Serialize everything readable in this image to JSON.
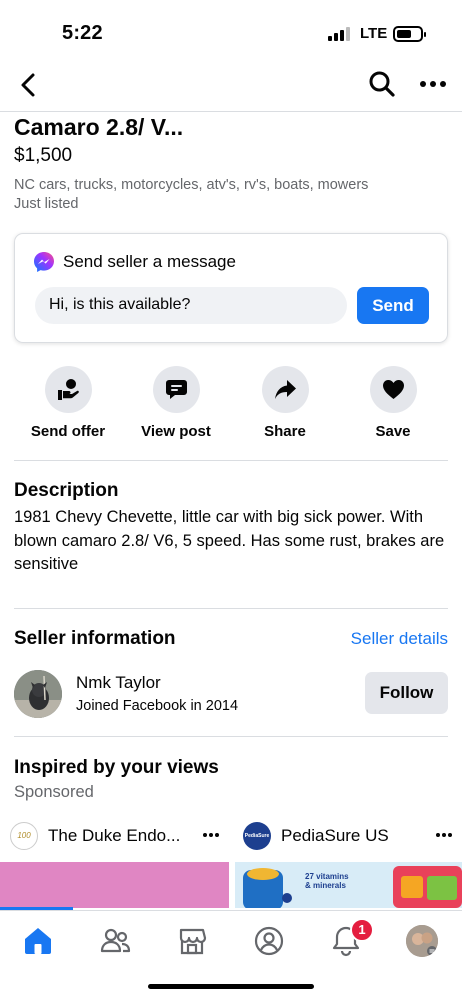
{
  "status": {
    "time": "5:22",
    "network": "LTE"
  },
  "listing": {
    "title": "Camaro 2.8/ V...",
    "price": "$1,500",
    "group": "NC cars, trucks, motorcycles, atv's, rv's, boats, mowers",
    "posted": "Just listed"
  },
  "message_card": {
    "title": "Send seller a message",
    "input_value": "Hi, is this available?",
    "send_label": "Send"
  },
  "actions": [
    {
      "label": "Send offer",
      "icon": "send-offer-icon"
    },
    {
      "label": "View post",
      "icon": "chat-bubble-icon"
    },
    {
      "label": "Share",
      "icon": "share-arrow-icon"
    },
    {
      "label": "Save",
      "icon": "heart-icon"
    }
  ],
  "description": {
    "heading": "Description",
    "text": "1981 Chevy Chevette, little car with big sick power. With blown camaro 2.8/ V6, 5 speed. Has some rust, brakes are sensitive"
  },
  "seller": {
    "heading": "Seller information",
    "details_link": "Seller details",
    "name": "Nmk Taylor",
    "joined": "Joined Facebook in 2014",
    "follow_label": "Follow"
  },
  "inspired": {
    "heading": "Inspired by your views",
    "sponsored": "Sponsored",
    "ads": [
      {
        "name": "The Duke Endo...",
        "logo_text": "100"
      },
      {
        "name": "PediaSure US",
        "logo_text": "PediaSure"
      }
    ],
    "ad2_text": "27 vitamins & minerals"
  },
  "tabbar": {
    "items": [
      "home-icon",
      "friends-icon",
      "marketplace-icon",
      "profile-icon",
      "notifications-icon",
      "menu-avatar-icon"
    ],
    "notification_count": "1"
  },
  "colors": {
    "accent": "#1877f2",
    "badge": "#e41e3f",
    "secondary_text": "#65676b"
  }
}
